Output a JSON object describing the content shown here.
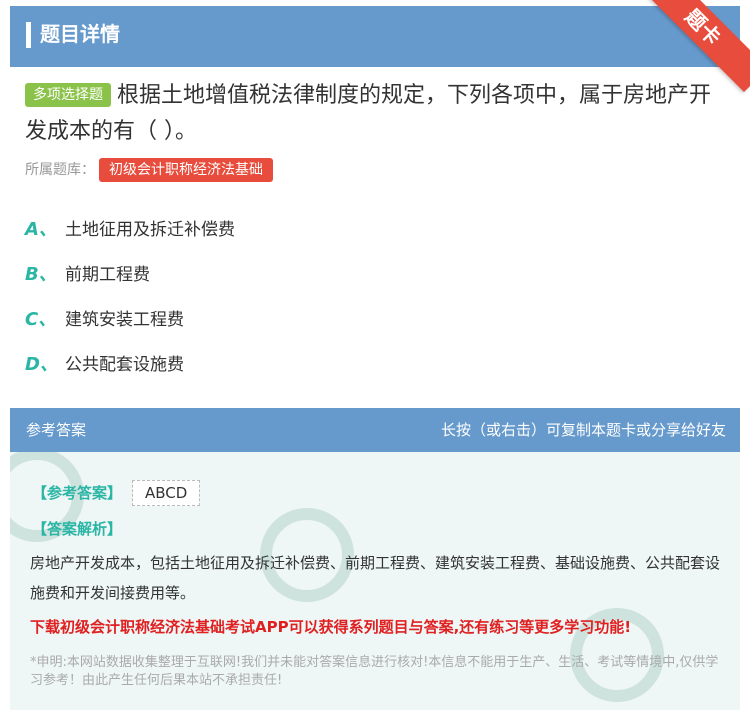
{
  "header": {
    "title": "题目详情",
    "corner_label": "题卡"
  },
  "question": {
    "type_label": "多项选择题",
    "text": "根据土地增值税法律制度的规定，下列各项中，属于房地产开发成本的有（   ）。",
    "bank_label": "所属题库：",
    "bank_name": "初级会计职称经济法基础"
  },
  "options": [
    {
      "letter": "A、",
      "text": "土地征用及拆迁补偿费"
    },
    {
      "letter": "B、",
      "text": "前期工程费"
    },
    {
      "letter": "C、",
      "text": "建筑安装工程费"
    },
    {
      "letter": "D、",
      "text": "公共配套设施费"
    }
  ],
  "answer": {
    "head_left": "参考答案",
    "head_right": "长按（或右击）可复制本题卡或分享给好友",
    "answer_label": "【参考答案】",
    "answer_value": "ABCD",
    "analysis_label": "【答案解析】",
    "analysis_text": "房地产开发成本，包括土地征用及拆迁补偿费、前期工程费、建筑安装工程费、基础设施费、公共配套设施费和开发间接费用等。",
    "promo": "下载初级会计职称经济法基础考试APP可以获得系列题目与答案,还有练习等更多学习功能!",
    "disclaimer": "*申明:本网站数据收集整理于互联网!我们并未能对答案信息进行核对!本信息不能用于生产、生活、考试等情境中,仅供学习参考！由此产生任何后果本站不承担责任!"
  },
  "colors": {
    "header_bg": "#6699cc",
    "accent_green": "#2bb5a5",
    "tag_red": "#e74c3c",
    "type_green": "#8bc34a"
  }
}
